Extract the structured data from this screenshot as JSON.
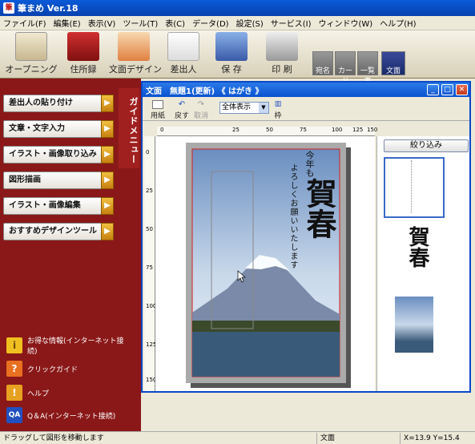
{
  "app": {
    "title": "筆まめ Ver.18",
    "icon_label": "筆"
  },
  "menu": [
    "ファイル(F)",
    "編集(E)",
    "表示(V)",
    "ツール(T)",
    "表(C)",
    "データ(D)",
    "設定(S)",
    "サービス(I)",
    "ウィンドウ(W)",
    "ヘルプ(H)"
  ],
  "toolbar": {
    "buttons": [
      "オープニング",
      "住所録",
      "文面デザイン",
      "差出人",
      "保 存",
      "印 刷"
    ],
    "modes": [
      "宛名",
      "カード",
      "一覧表",
      "文面"
    ],
    "active_mode": "文面"
  },
  "sidebar": {
    "guide_tab": "ガイドメニュー",
    "buttons": [
      "差出人の貼り付け",
      "文章・文字入力",
      "イラスト・画像取り込み",
      "図形描画",
      "イラスト・画像編集",
      "おすすめデザインツール"
    ],
    "links": [
      "お得な情報(インターネット接続)",
      "クリックガイド",
      "ヘルプ",
      "Q＆A(インターネット接続)"
    ],
    "link_icons": [
      "i",
      "?",
      "!",
      "QA"
    ]
  },
  "document": {
    "title": "文面　無題1(更新) 《 はがき 》",
    "tools": [
      "用紙",
      "戻す",
      "取消",
      "枠"
    ],
    "zoom": "全体表示",
    "filter_button": "絞り込み",
    "ruler_h": [
      "0",
      "25",
      "50",
      "75",
      "100",
      "125",
      "150"
    ],
    "ruler_v": [
      "0",
      "25",
      "50",
      "75",
      "100",
      "125",
      "150"
    ],
    "card_text": {
      "small": "今年も",
      "greeting": "よろしくお願いいたします",
      "main": "賀春"
    }
  },
  "statusbar": {
    "message": "ドラッグして図形を移動します",
    "mode": "文面",
    "coords": "X=13.9 Y=15.4"
  },
  "colors": {
    "sidebar": "#8a1818",
    "title_blue": "#0a52d0",
    "accent_orange": "#e0a020"
  }
}
